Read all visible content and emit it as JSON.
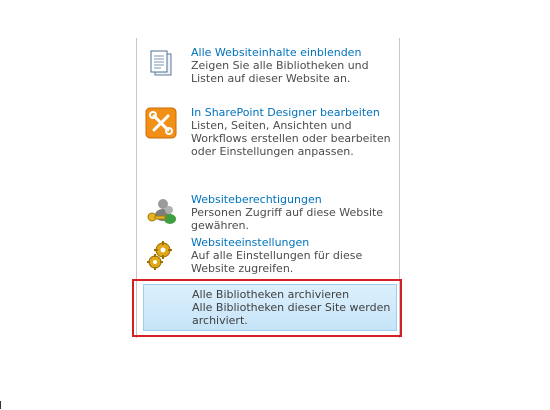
{
  "menu": {
    "items": [
      {
        "icon": "document-list-icon",
        "title": "Alle Websiteinhalte einblenden",
        "description": "Zeigen Sie alle Bibliotheken und Listen auf dieser Website an."
      },
      {
        "icon": "sharepoint-designer-icon",
        "title": "In SharePoint Designer bearbeiten",
        "description": "Listen, Seiten, Ansichten und Workflows erstellen oder bearbeiten oder Einstellungen anpassen."
      },
      {
        "icon": "people-keys-icon",
        "title": "Websiteberechtigungen",
        "description": "Personen Zugriff auf diese Website gewähren."
      },
      {
        "icon": "gears-icon",
        "title": "Websiteeinstellungen",
        "description": "Auf alle Einstellungen für diese Website zugreifen."
      },
      {
        "title": "Alle Bibliotheken archivieren",
        "description": "Alle Bibliotheken dieser Site werden archiviert."
      }
    ]
  },
  "colors": {
    "link": "#0072bc",
    "highlight_border": "#d41f26",
    "highlight_bg": "#cfe9fb"
  }
}
